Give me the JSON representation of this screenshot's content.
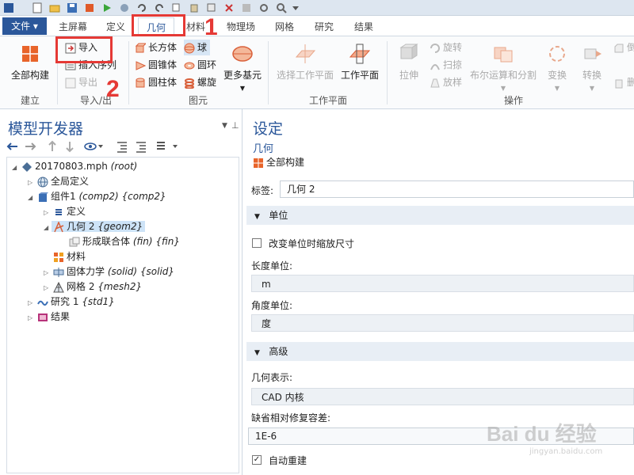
{
  "ribbon_tabs": {
    "file": "文件",
    "home": "主屏幕",
    "definitions": "定义",
    "geometry": "几何",
    "materials": "材料",
    "physics": "物理场",
    "mesh": "网格",
    "study": "研究",
    "results": "结果"
  },
  "ribbon": {
    "build_all": "全部构建",
    "group_build": "建立",
    "import": "导入",
    "insert_sequence": "插入序列",
    "export": "导出",
    "group_import_export": "导入/出",
    "block": "长方体",
    "cone": "圆锥体",
    "cylinder": "圆柱体",
    "sphere": "球",
    "torus": "圆环",
    "helix": "螺旋",
    "more_primitives": "更多基元",
    "group_primitives": "图元",
    "select_work_plane": "选择工作平面",
    "work_plane": "工作平面",
    "group_work_planes": "工作平面",
    "extrude": "拉伸",
    "revolve": "旋转",
    "sweep": "扫掠",
    "loft": "放样",
    "booleans_partitions": "布尔运算和分割",
    "transforms": "变换",
    "conversions": "转换",
    "group_operations": "操作",
    "chamfer": "倒",
    "delete": "删"
  },
  "annotations": {
    "step1": "1",
    "step2": "2"
  },
  "model_builder": {
    "title": "模型开发器",
    "tree": {
      "root": {
        "label": "20170803.mph",
        "tag": "(root)"
      },
      "global_definitions": "全局定义",
      "component": {
        "label": "组件1",
        "tag": "(comp2) {comp2}"
      },
      "definitions": "定义",
      "geometry": {
        "label": "几何 2",
        "tag": "{geom2}"
      },
      "form_union": {
        "label": "形成联合体",
        "tag": "(fin) {fin}"
      },
      "materials": "材料",
      "solid_mechanics": {
        "label": "固体力学",
        "tag": "(solid) {solid}"
      },
      "mesh": {
        "label": "网格 2",
        "tag": "{mesh2}"
      },
      "study": {
        "label": "研究 1",
        "tag": "{std1}"
      },
      "results": "结果"
    }
  },
  "settings": {
    "title": "设定",
    "subtitle": "几何",
    "build_all": "全部构建",
    "label_caption": "标签:",
    "label_value": "几何 2",
    "units_section": "单位",
    "scale_values_checkbox": "改变单位时缩放尺寸",
    "scale_values_checked": false,
    "length_unit_label": "长度单位:",
    "length_unit_value": "m",
    "angular_unit_label": "角度单位:",
    "angular_unit_value": "度",
    "advanced_section": "高级",
    "geometry_representation_label": "几何表示:",
    "geometry_representation_value": "CAD 内核",
    "default_repair_tolerance_label": "缺省相对修复容差:",
    "default_repair_tolerance_value": "1E-6",
    "automatic_rebuild": "自动重建",
    "automatic_rebuild_checked": true
  },
  "watermark": {
    "logo": "Bai du 经验",
    "url": "jingyan.baidu.com"
  },
  "colors": {
    "accent": "#2b579a",
    "annotation": "#e53935",
    "selection": "#cde3f7"
  }
}
